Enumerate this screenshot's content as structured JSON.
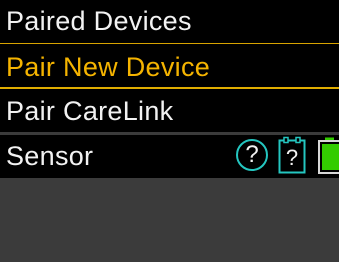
{
  "header": {
    "title": "Paired Devices"
  },
  "menu": {
    "items": [
      {
        "label": "Pair New Device",
        "selected": true
      },
      {
        "label": "Pair CareLink",
        "selected": false
      },
      {
        "label": "Sensor",
        "selected": false
      }
    ]
  },
  "sensor_status": {
    "help_glyph": "?",
    "sensor_glyph": "?",
    "icons": [
      "help-icon",
      "sensor-icon",
      "battery-icon"
    ]
  },
  "colors": {
    "accent": "#f5b400",
    "icon_teal": "#24c6c0",
    "battery_green": "#33cc00",
    "background": "#000000",
    "panel": "#3b3b3b",
    "text": "#f2f2f2"
  }
}
